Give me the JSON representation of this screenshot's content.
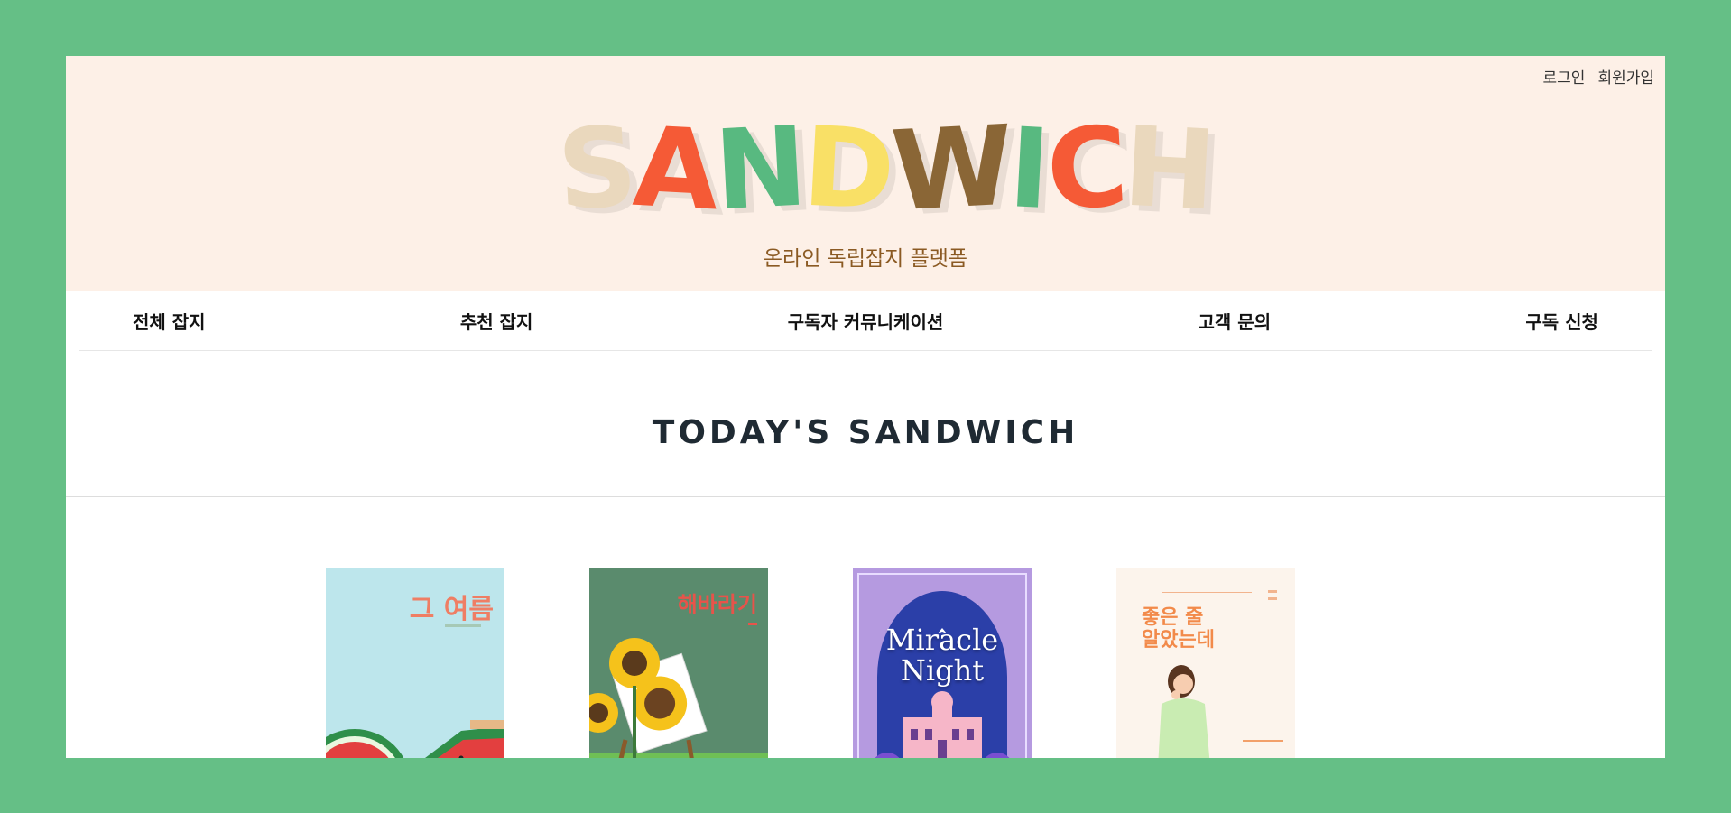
{
  "header": {
    "auth": {
      "login": "로그인",
      "signup": "회원가입"
    },
    "logo": {
      "letters": [
        "S",
        "A",
        "N",
        "D",
        "W",
        "I",
        "C",
        "H"
      ],
      "colors": [
        "#ead8bd",
        "#f55a36",
        "#58b980",
        "#f9e066",
        "#8a6636",
        "#58b980",
        "#f55a36",
        "#ead8bd"
      ]
    },
    "tagline": "온라인 독립잡지 플랫폼"
  },
  "nav": {
    "items": [
      "전체 잡지",
      "추천 잡지",
      "구독자 커뮤니케이션",
      "고객 문의",
      "구독 신청"
    ]
  },
  "section": {
    "title": "TODAY'S SANDWICH"
  },
  "books": [
    {
      "title": "그 여름",
      "cover_color": "#bde6ec",
      "icon": "watermelon-illustration"
    },
    {
      "title": "해바라기",
      "cover_color": "#5a8b6d",
      "icon": "sunflower-illustration"
    },
    {
      "title": "Miracle\nNight",
      "cover_color": "#b59ae0",
      "icon": "castle-illustration"
    },
    {
      "title": "좋은 줄\n알았는데",
      "cover_color": "#fcf4ec",
      "icon": "woman-illustration"
    }
  ]
}
